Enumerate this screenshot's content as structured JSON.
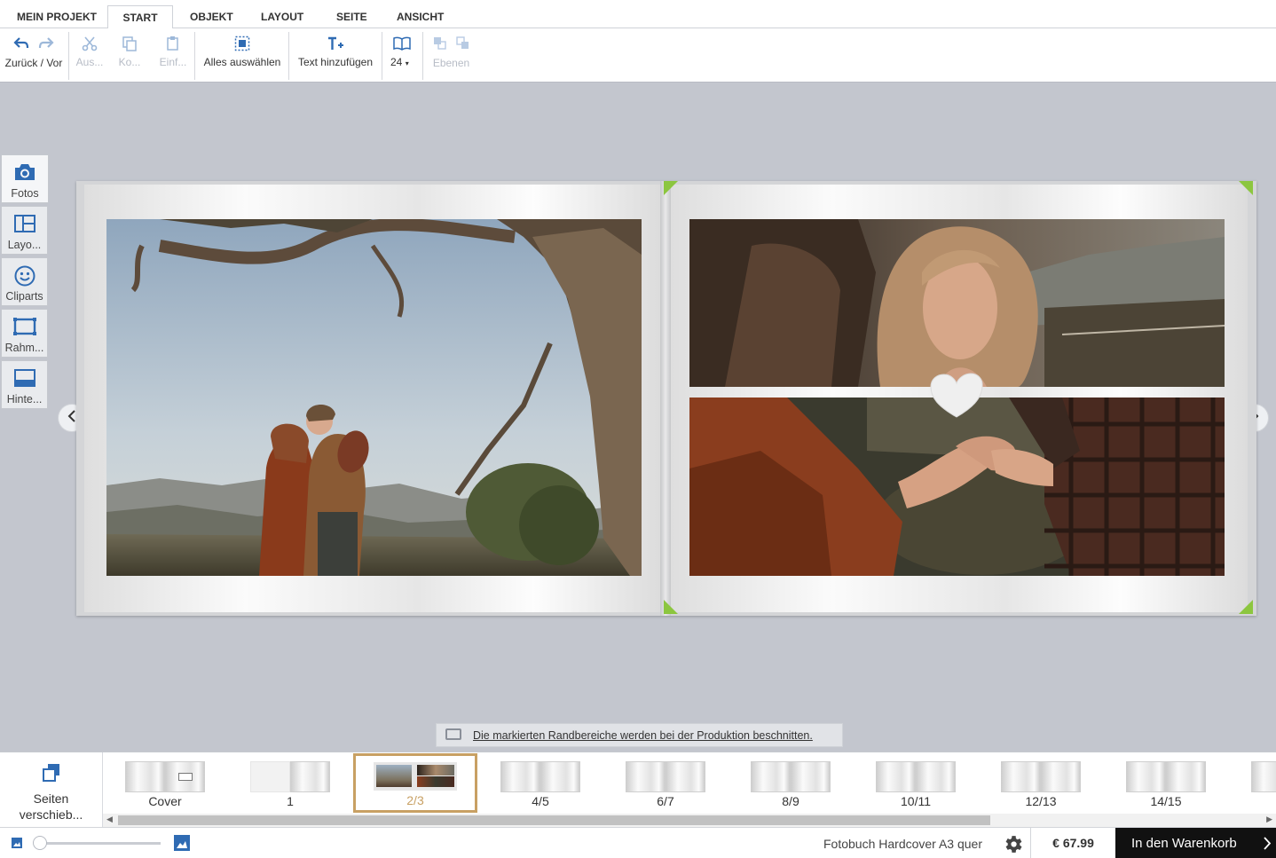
{
  "menu": {
    "tabs": [
      "MEIN PROJEKT",
      "START",
      "OBJEKT",
      "LAYOUT",
      "SEITE",
      "ANSICHT"
    ],
    "active_tab": "START"
  },
  "toolbar": {
    "undo_redo_label": "Zurück / Vor",
    "cut_label": "Aus...",
    "copy_label": "Ko...",
    "paste_label": "Einf...",
    "select_all_label": "Alles auswählen",
    "add_text_label": "Text hinzufügen",
    "font_size_value": "24",
    "layers_label": "Ebenen"
  },
  "side_panel": {
    "photos": "Fotos",
    "layouts": "Layo...",
    "cliparts": "Cliparts",
    "frames": "Rahm...",
    "backgrounds": "Hinte..."
  },
  "notice": {
    "text": "Die markierten Randbereiche werden bei der Produktion beschnitten."
  },
  "pages_strip": {
    "reorder_label_1": "Seiten",
    "reorder_label_2": "verschieb...",
    "thumbnails": [
      "Cover",
      "1",
      "2/3",
      "4/5",
      "6/7",
      "8/9",
      "10/11",
      "12/13",
      "14/15"
    ],
    "active": "2/3"
  },
  "footer": {
    "product": "Fotobuch Hardcover A3 quer",
    "price": "€ 67.99",
    "cart_button": "In den Warenkorb"
  },
  "colors": {
    "accent_blue": "#2f6bb3",
    "active_thumb_border": "#c8a063",
    "trim_marker": "#8cc63f",
    "cart_bg": "#111111"
  },
  "icons": [
    "undo-icon",
    "redo-icon",
    "cut-icon",
    "copy-icon",
    "paste-icon",
    "select-all-icon",
    "add-text-icon",
    "book-view-icon",
    "layer-front-icon",
    "layer-back-icon",
    "camera-icon",
    "layout-icon",
    "smiley-icon",
    "frame-icon",
    "background-icon",
    "chevron-left-icon",
    "chevron-right-icon",
    "reorder-pages-icon",
    "small-image-icon",
    "large-image-icon",
    "gear-icon"
  ]
}
